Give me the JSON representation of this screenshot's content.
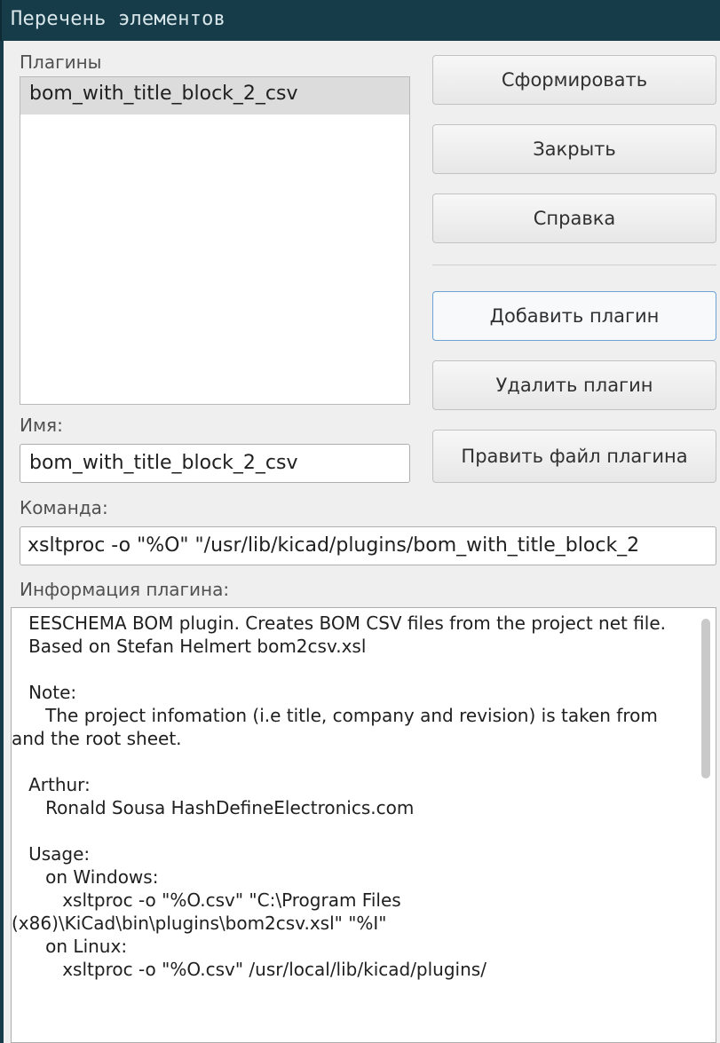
{
  "window": {
    "title": "Перечень элементов"
  },
  "plugins": {
    "label": "Плагины",
    "items": [
      "bom_with_title_block_2_csv"
    ]
  },
  "name": {
    "label": "Имя:",
    "value": "bom_with_title_block_2_csv"
  },
  "command": {
    "label": "Команда:",
    "value": "xsltproc -o \"%O\" \"/usr/lib/kicad/plugins/bom_with_title_block_2"
  },
  "info": {
    "label": "Информация плагина:",
    "text": "   EESCHEMA BOM plugin. Creates BOM CSV files from the project net file.\n   Based on Stefan Helmert bom2csv.xsl\n\n   Note:\n      The project infomation (i.e title, company and revision) is taken from and the root sheet.\n\n   Arthur:\n      Ronald Sousa HashDefineElectronics.com\n\n   Usage:\n      on Windows:\n         xsltproc -o \"%O.csv\" \"C:\\Program Files (x86)\\KiCad\\bin\\plugins\\bom2csv.xsl\" \"%I\"\n      on Linux:\n         xsltproc -o \"%O.csv\" /usr/local/lib/kicad/plugins/"
  },
  "buttons": {
    "generate": "Сформировать",
    "close": "Закрыть",
    "help": "Справка",
    "add_plugin": "Добавить плагин",
    "remove_plugin": "Удалить плагин",
    "edit_plugin_file": "Править файл плагина"
  }
}
